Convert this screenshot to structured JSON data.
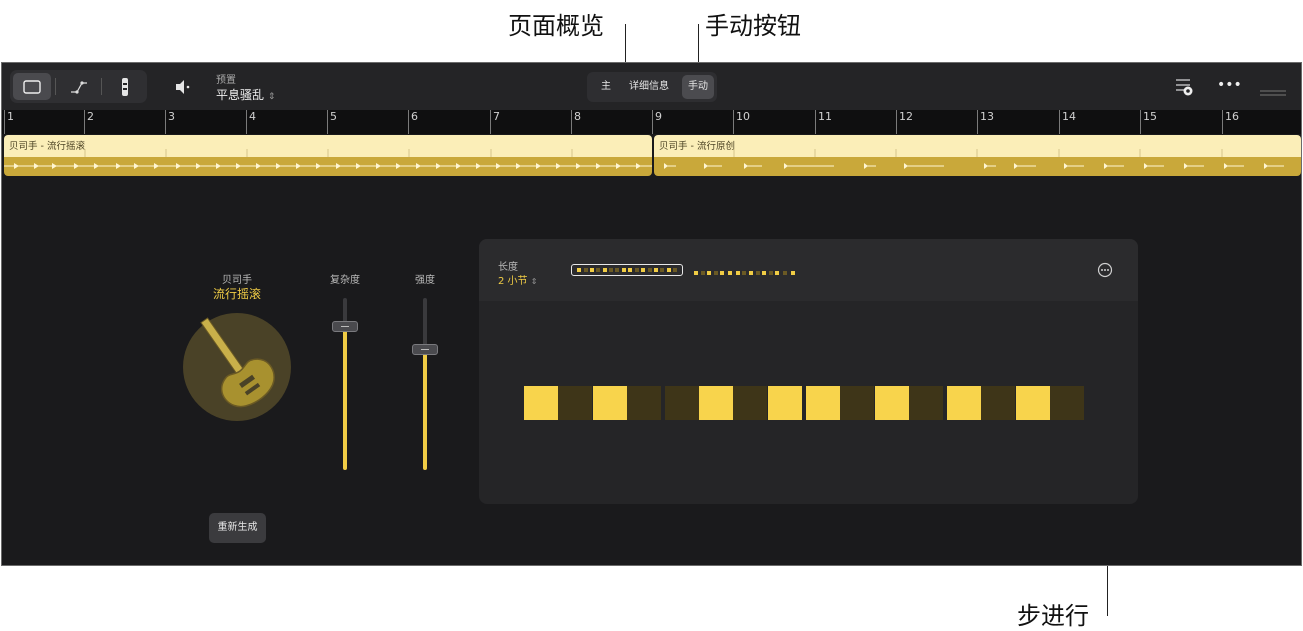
{
  "callouts": {
    "page_overview": "页面概览",
    "manual_button": "手动按钮",
    "step_sequence": "步进行"
  },
  "toolbar": {
    "preset_label": "预置",
    "preset_value": "平息骚乱",
    "tabs": [
      {
        "label": "主",
        "active": false
      },
      {
        "label": "详细信息",
        "active": false
      },
      {
        "label": "手动",
        "active": true
      }
    ],
    "icons": [
      "region-view-icon",
      "automation-icon",
      "metronome-icon",
      "volume-icon",
      "plugin-settings-icon",
      "more-icon",
      "drag-handle-icon"
    ]
  },
  "ruler": {
    "bars": [
      "1",
      "2",
      "3",
      "4",
      "5",
      "6",
      "7",
      "8",
      "9",
      "10",
      "11",
      "12",
      "13",
      "14",
      "15",
      "16"
    ]
  },
  "regions": [
    {
      "title": "贝司手 - 流行摇滚"
    },
    {
      "title": "贝司手 - 流行原创"
    }
  ],
  "player": {
    "role": "贝司手",
    "style": "流行摇滚",
    "regenerate_label": "重新生成"
  },
  "sliders": {
    "complexity_label": "复杂度",
    "complexity_level": 0.84,
    "intensity_label": "强度",
    "intensity_level": 0.7
  },
  "step_editor": {
    "length_label": "长度",
    "length_value": "2 小节",
    "page_count": 2,
    "current_page": 1,
    "steps": [
      true,
      false,
      true,
      false,
      false,
      true,
      false,
      true,
      true,
      false,
      true,
      false,
      true,
      false,
      true,
      false
    ]
  },
  "colors": {
    "accent": "#f8d44c",
    "region_light": "#fbeeb8",
    "region_dark": "#c9a83a",
    "background": "#1a1a1c"
  }
}
